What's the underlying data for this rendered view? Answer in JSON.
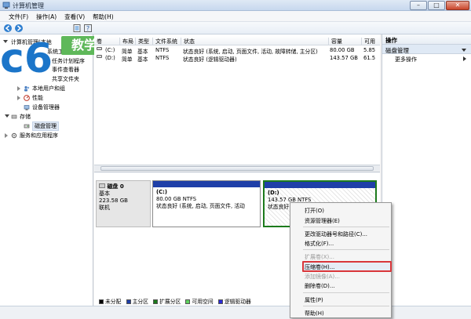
{
  "window": {
    "title": "计算机管理"
  },
  "menu": [
    "文件(F)",
    "操作(A)",
    "查看(V)",
    "帮助(H)"
  ],
  "tree": {
    "root": "计算机管理(本地",
    "items": [
      "系统工具",
      "任务计划程序",
      "事件查看器",
      "共享文件夹",
      "本地用户和组",
      "性能",
      "设备管理器",
      "存储",
      "磁盘管理",
      "服务和应用程序"
    ]
  },
  "volumes": {
    "columns": [
      "卷",
      "布局",
      "类型",
      "文件系统",
      "状态",
      "容量",
      "可用"
    ],
    "rows": [
      {
        "vol": "(C:)",
        "layout": "简单",
        "type": "基本",
        "fs": "NTFS",
        "status": "状态良好 (系统, 启动, 页面文件, 活动, 故障转储, 主分区)",
        "capacity": "80.00 GB",
        "free": "5.85"
      },
      {
        "vol": "(D:)",
        "layout": "简单",
        "type": "基本",
        "fs": "NTFS",
        "status": "状态良好 (逻辑驱动器)",
        "capacity": "143.57 GB",
        "free": "61.5"
      }
    ]
  },
  "disk": {
    "name": "磁盘 0",
    "type": "基本",
    "size": "223.58 GB",
    "state": "联机",
    "partitions": [
      {
        "label": "(C:)",
        "size_fs": "80.00 GB NTFS",
        "status": "状态良好 (系统, 启动, 页面文件, 活动"
      },
      {
        "label": "(D:)",
        "size_fs": "143.57 GB NTFS",
        "status": "状态良好 (逻"
      }
    ]
  },
  "legend": [
    {
      "label": "未分配",
      "color": "#000000"
    },
    {
      "label": "主分区",
      "color": "#1f3fa8"
    },
    {
      "label": "扩展分区",
      "color": "#1c7a1c"
    },
    {
      "label": "可用空间",
      "color": "#5fd35f"
    },
    {
      "label": "逻辑驱动器",
      "color": "#2a2ad8"
    }
  ],
  "actions": {
    "header": "操作",
    "section": "磁盘管理",
    "more": "更多操作"
  },
  "context_menu": {
    "items": [
      {
        "label": "打开(O)",
        "enabled": true
      },
      {
        "label": "资源管理器(E)",
        "enabled": true
      },
      {
        "label": "更改驱动器号和路径(C)...",
        "enabled": true
      },
      {
        "label": "格式化(F)...",
        "enabled": true
      },
      {
        "label": "扩展卷(X)...",
        "enabled": false
      },
      {
        "label": "压缩卷(H)...",
        "enabled": true
      },
      {
        "label": "添加镜像(A)...",
        "enabled": false
      },
      {
        "label": "删除卷(D)...",
        "enabled": true
      },
      {
        "label": "属性(P)",
        "enabled": true
      },
      {
        "label": "帮助(H)",
        "enabled": true
      }
    ],
    "highlighted": "压缩卷(H)..."
  },
  "watermark": {
    "text": "c6",
    "badge": "教学"
  },
  "colors": {
    "accent": "#1f3fa8",
    "highlight_box": "#d9363a",
    "logo_green": "#5fb85a",
    "logo_blue": "#1b75c9"
  }
}
